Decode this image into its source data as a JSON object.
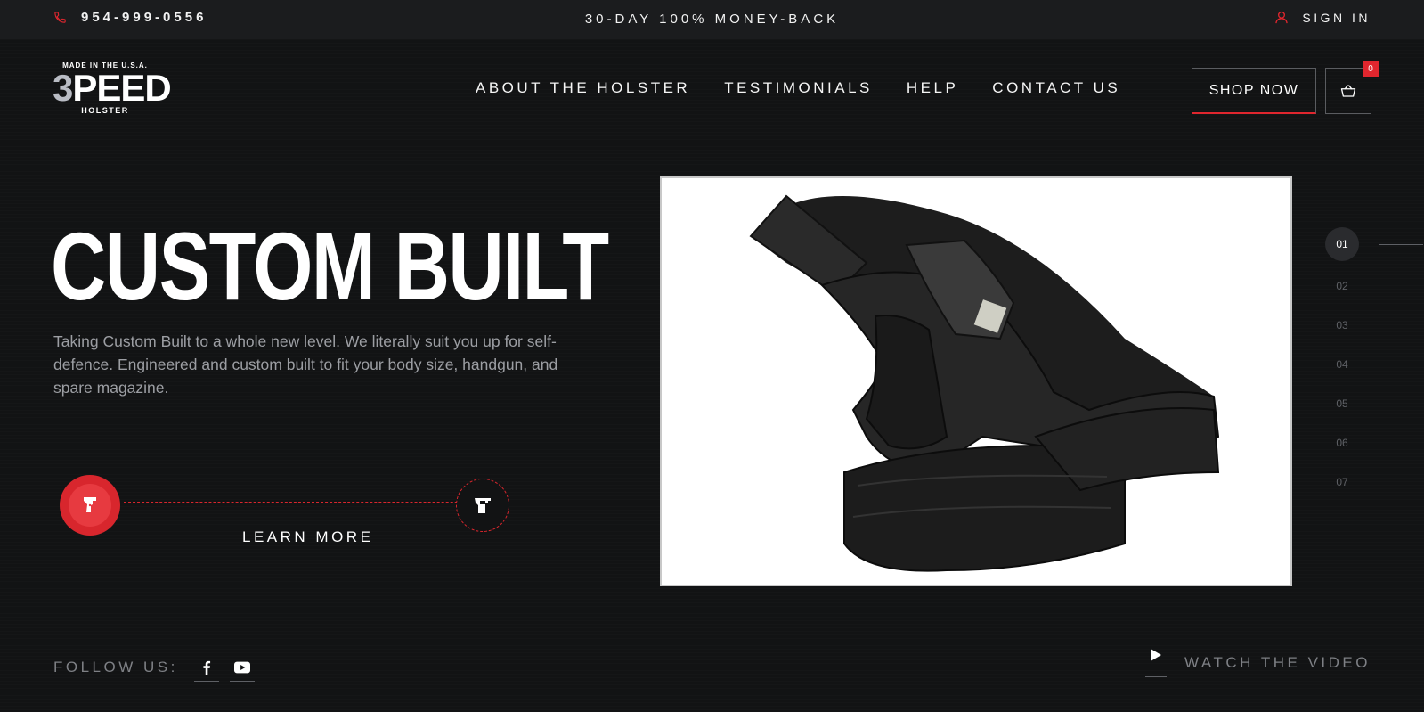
{
  "topbar": {
    "phone": "954-999-0556",
    "promo": "30-DAY 100% MONEY-BACK",
    "signin": "SIGN IN"
  },
  "logo": {
    "made_in": "MADE IN THE U.S.A.",
    "brand": "3PEED",
    "sub": "HOLSTER"
  },
  "nav": {
    "items": [
      "ABOUT THE HOLSTER",
      "TESTIMONIALS",
      "HELP",
      "CONTACT US"
    ]
  },
  "header": {
    "shop_now": "SHOP NOW",
    "cart_count": "0"
  },
  "hero": {
    "title": "CUSTOM BUILT",
    "description": "Taking Custom Built to a whole new level. We literally suit you up for self-defence. Engineered and custom built to fit your body size, handgun, and spare magazine.",
    "learn_more": "LEARN MORE",
    "image_alt": "Black ankle holster with pistol"
  },
  "pager": {
    "items": [
      "01",
      "02",
      "03",
      "04",
      "05",
      "06",
      "07"
    ],
    "active_index": 0
  },
  "footer": {
    "follow_label": "FOLLOW US:",
    "social": [
      "facebook-icon",
      "youtube-icon"
    ],
    "watch_video": "WATCH THE VIDEO"
  },
  "colors": {
    "accent": "#e0262e",
    "background": "#121314",
    "topbar": "#1b1c1e",
    "muted_text": "#9c9ea3"
  }
}
